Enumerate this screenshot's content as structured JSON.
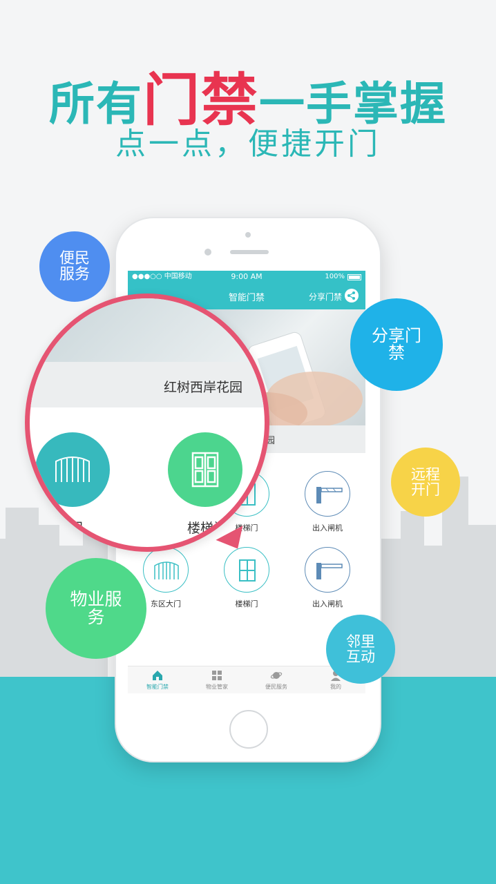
{
  "headline": {
    "part1": "所有",
    "highlight": "门禁",
    "part2": "一手掌握"
  },
  "subline": "点一点，便捷开门",
  "phone": {
    "status": {
      "carrier": "●●●○○ 中国移动",
      "time": "9:00 AM",
      "battery": "100%"
    },
    "nav": {
      "title": "智能门禁",
      "share": "分享门禁"
    },
    "community_fragment": "园",
    "grid": [
      {
        "label": "楼梯门",
        "icon": "stair-door-icon"
      },
      {
        "label": "出入闸机",
        "icon": "barrier-gate-icon"
      },
      {
        "label": "东区大门",
        "icon": "gate-icon"
      },
      {
        "label": "楼梯门",
        "icon": "stair-door-icon"
      },
      {
        "label": "出入闸机",
        "icon": "barrier-gate-icon"
      }
    ],
    "tabs": [
      {
        "label": "智能门禁",
        "icon": "home-icon"
      },
      {
        "label": "物业管家",
        "icon": "grid-icon"
      },
      {
        "label": "便民服务",
        "icon": "planet-icon"
      },
      {
        "label": "我的",
        "icon": "person-icon"
      }
    ]
  },
  "magnifier": {
    "title": "红树西岸花园",
    "gate_label": "区大门",
    "stair_label": "楼梯门"
  },
  "bubbles": {
    "convenience": "便民服务",
    "share": "分享门禁",
    "remote": "远程开门",
    "property": "物业服务",
    "neighbor": "邻里互动"
  },
  "colors": {
    "teal": "#35c1c7",
    "accent_red": "#e83450",
    "blue": "#4f8ef0",
    "cyan": "#1fb2e8",
    "yellow": "#f7d348",
    "green": "#4fd98a"
  }
}
